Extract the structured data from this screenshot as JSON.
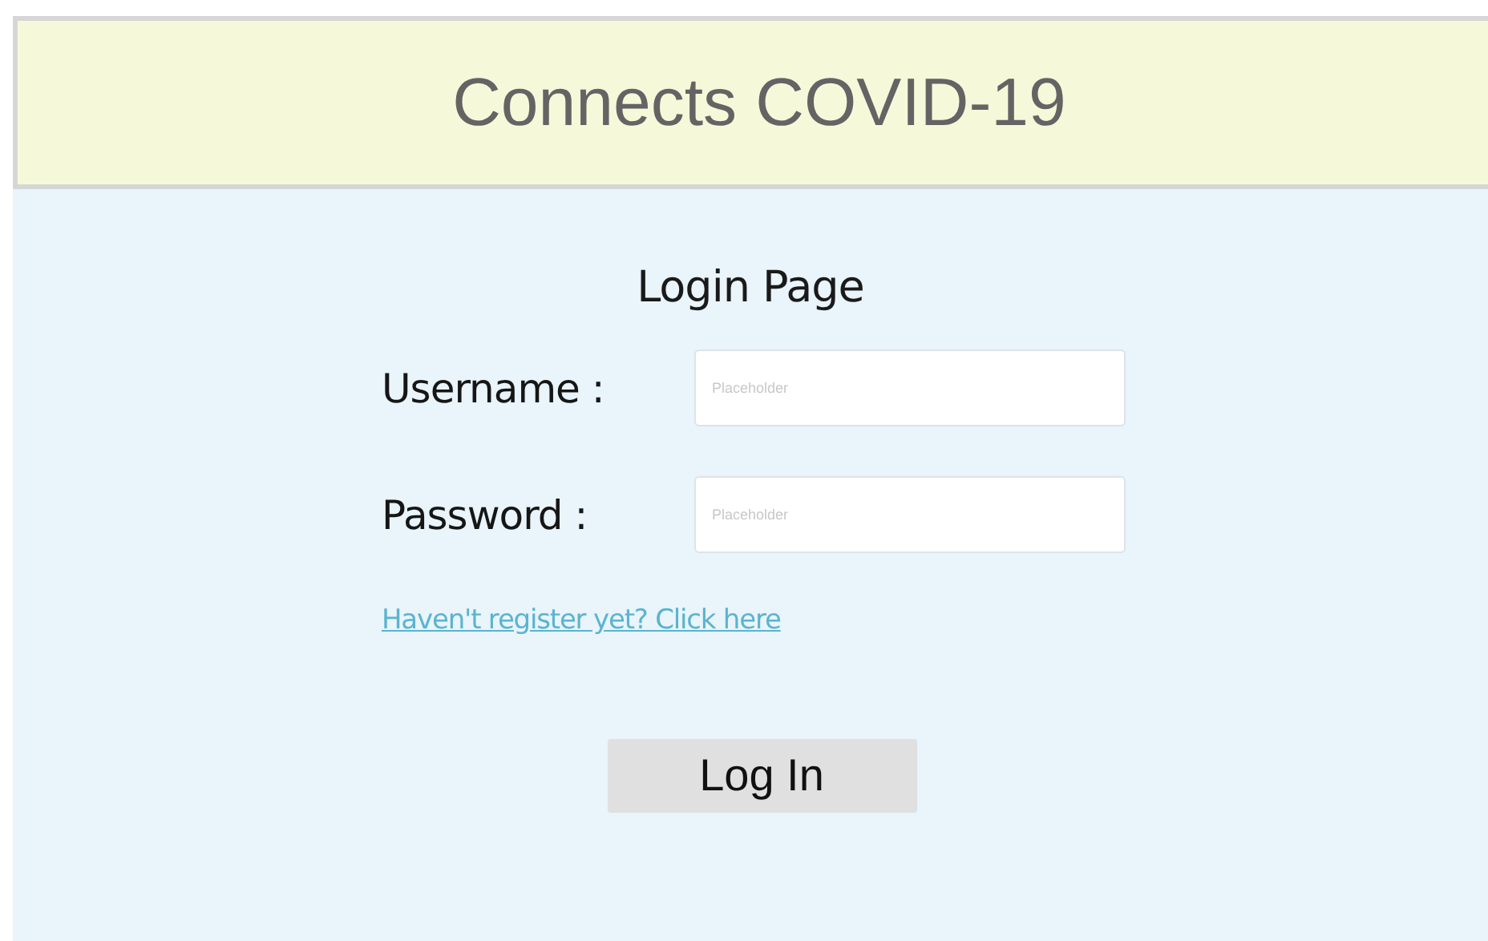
{
  "header": {
    "title": "Connects COVID-19"
  },
  "form": {
    "title": "Login Page",
    "fields": [
      {
        "label": "Username :",
        "placeholder": "Placeholder"
      },
      {
        "label": "Password :",
        "placeholder": "Placeholder"
      }
    ],
    "register_link": "Haven't register yet? Click here",
    "submit": "Log In"
  }
}
